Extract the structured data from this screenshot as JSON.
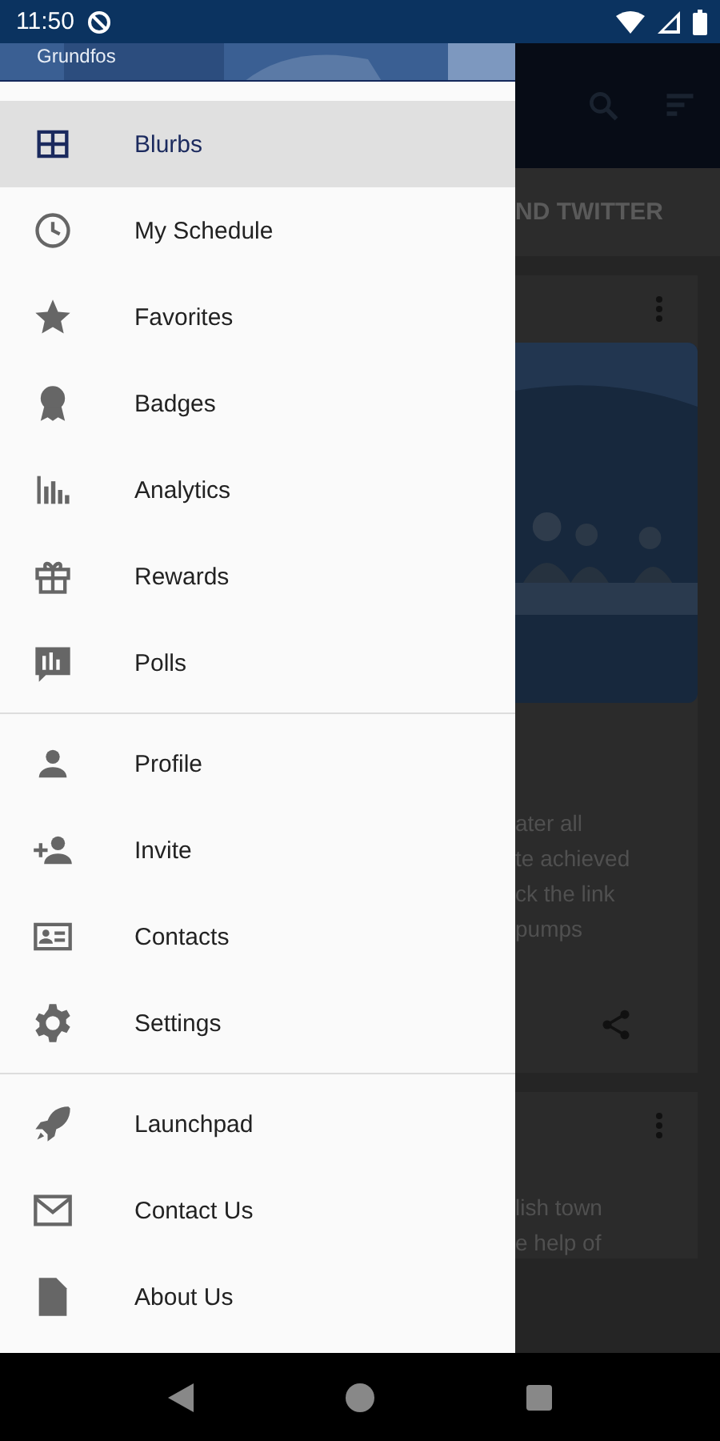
{
  "status_bar": {
    "time": "11:50"
  },
  "drawer": {
    "header": {
      "title": "Grundfos"
    },
    "sections": [
      {
        "items": [
          {
            "label": "Blurbs",
            "kind": "grid",
            "selected": true
          },
          {
            "label": "My Schedule",
            "kind": "clock",
            "selected": false
          },
          {
            "label": "Favorites",
            "kind": "star",
            "selected": false
          },
          {
            "label": "Badges",
            "kind": "badge",
            "selected": false
          },
          {
            "label": "Analytics",
            "kind": "bars",
            "selected": false
          },
          {
            "label": "Rewards",
            "kind": "gift",
            "selected": false
          },
          {
            "label": "Polls",
            "kind": "poll",
            "selected": false
          }
        ]
      },
      {
        "items": [
          {
            "label": "Profile",
            "kind": "person",
            "selected": false
          },
          {
            "label": "Invite",
            "kind": "invite",
            "selected": false
          },
          {
            "label": "Contacts",
            "kind": "card",
            "selected": false
          },
          {
            "label": "Settings",
            "kind": "gear",
            "selected": false
          }
        ]
      },
      {
        "items": [
          {
            "label": "Launchpad",
            "kind": "rocket",
            "selected": false
          },
          {
            "label": "Contact Us",
            "kind": "mail",
            "selected": false
          },
          {
            "label": "About Us",
            "kind": "doc",
            "selected": false
          }
        ]
      }
    ]
  },
  "background": {
    "tabs": [
      "ND TWITTER"
    ],
    "card_text": [
      "ater all",
      "te achieved",
      "ck the link",
      "pumps"
    ],
    "card2_text": [
      "lish town",
      "e help of"
    ]
  }
}
